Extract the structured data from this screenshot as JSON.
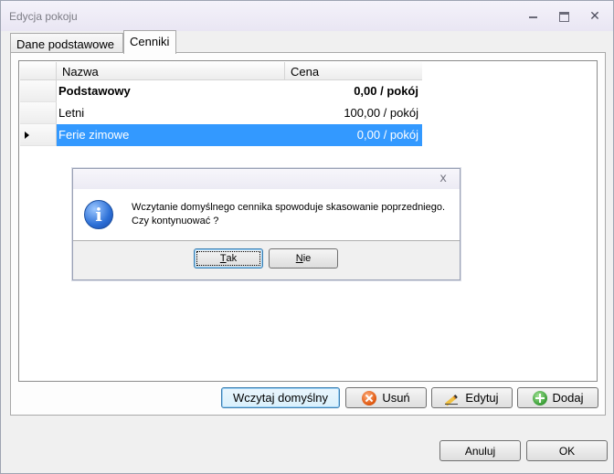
{
  "window": {
    "title": "Edycja pokoju"
  },
  "tabs": [
    {
      "label": "Dane podstawowe"
    },
    {
      "label": "Cenniki"
    }
  ],
  "grid": {
    "columns": [
      "Nazwa",
      "Cena"
    ],
    "rows": [
      {
        "name": "Podstawowy",
        "price": "0,00 / pokój",
        "bold": true,
        "selected": false
      },
      {
        "name": "Letni",
        "price": "100,00 / pokój",
        "bold": false,
        "selected": false
      },
      {
        "name": "Ferie zimowe",
        "price": "0,00 / pokój",
        "bold": false,
        "selected": true
      }
    ]
  },
  "toolbar": {
    "load_default": "Wczytaj domyślny",
    "delete": "Usuń",
    "edit": "Edytuj",
    "add": "Dodaj"
  },
  "footer": {
    "cancel": "Anuluj",
    "ok": "OK"
  },
  "dialog": {
    "close_glyph": "x",
    "icon_glyph": "i",
    "message_line1": "Wczytanie domyślnego  cennika spowoduje skasowanie poprzedniego.",
    "message_line2": "Czy kontynuować ?",
    "yes_key": "T",
    "yes_rest": "ak",
    "no_key": "N",
    "no_rest": "ie"
  },
  "colors": {
    "selection": "#3399ff",
    "info_icon": "#2c6fd6"
  }
}
